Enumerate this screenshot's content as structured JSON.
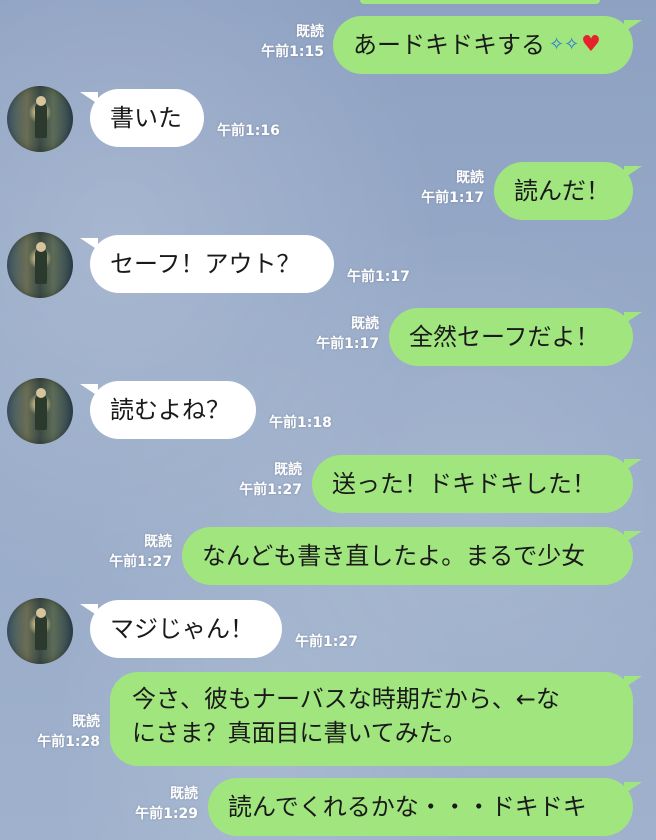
{
  "chat": {
    "messages": [
      {
        "dir": "out",
        "text": "あードキドキする",
        "emoji": [
          "sparkle-face",
          "heart"
        ],
        "read": "既読",
        "time": "午前1:15"
      },
      {
        "dir": "in",
        "text": "書いた",
        "time": "午前1:16"
      },
      {
        "dir": "out",
        "text": "読んだ！",
        "read": "既読",
        "time": "午前1:17"
      },
      {
        "dir": "in",
        "text": "セーフ！アウト？",
        "time": "午前1:17"
      },
      {
        "dir": "out",
        "text": "全然セーフだよ！",
        "read": "既読",
        "time": "午前1:17"
      },
      {
        "dir": "in",
        "text": "読むよね？",
        "time": "午前1:18"
      },
      {
        "dir": "out",
        "text": "送った！ドキドキした！",
        "read": "既読",
        "time": "午前1:27"
      },
      {
        "dir": "out",
        "text": "なんども書き直したよ。まるで少女",
        "read": "既読",
        "time": "午前1:27"
      },
      {
        "dir": "in",
        "text": "マジじゃん！",
        "time": "午前1:27"
      },
      {
        "dir": "out",
        "text": "今さ、彼もナーバスな時期だから、←なにさま？真面目に書いてみた。",
        "line1": "今さ、彼もナーバスな時期だから、←な",
        "line2": "にさま？真面目に書いてみた。",
        "read": "既読",
        "time": "午前1:28"
      },
      {
        "dir": "out",
        "text": "読んでくれるかな・・・ドキドキ",
        "read": "既読",
        "time": "午前1:29"
      }
    ]
  },
  "colors": {
    "outgoing_bubble": "#a1e57e",
    "incoming_bubble": "#ffffff",
    "background": "#96a9c7",
    "meta_text": "#ffffff"
  }
}
